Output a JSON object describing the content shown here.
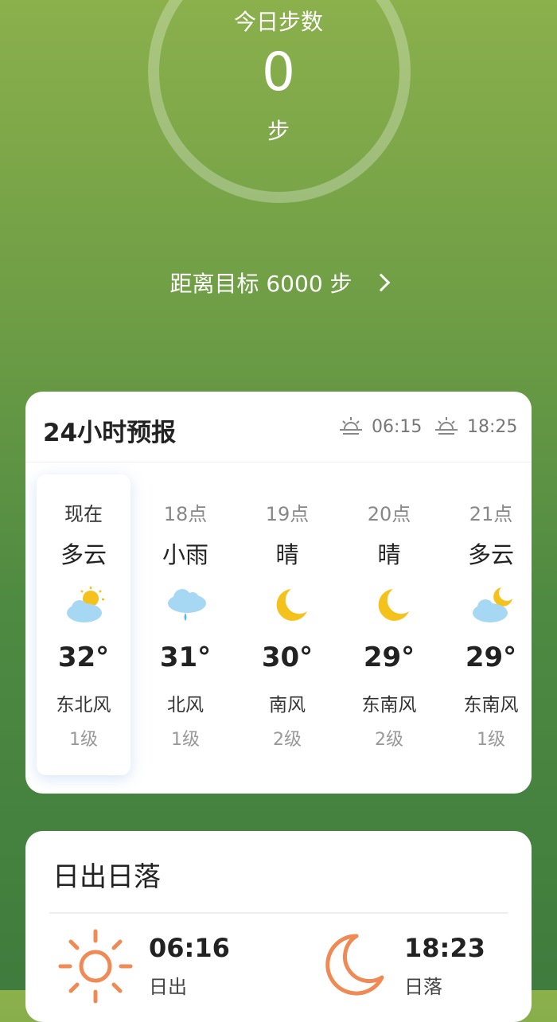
{
  "steps": {
    "title": "今日步数",
    "count": "0",
    "unit": "步",
    "goal_text": "距离目标 6000 步"
  },
  "forecast": {
    "title": "24小时预报",
    "sunrise": "06:15",
    "sunset": "18:25",
    "hours": [
      {
        "time": "现在",
        "condition": "多云",
        "icon": "partly-cloudy-icon",
        "temp": "32°",
        "wind": "东北风",
        "level": "1级"
      },
      {
        "time": "18点",
        "condition": "小雨",
        "icon": "rain-icon",
        "temp": "31°",
        "wind": "北风",
        "level": "1级"
      },
      {
        "time": "19点",
        "condition": "晴",
        "icon": "moon-icon",
        "temp": "30°",
        "wind": "南风",
        "level": "2级"
      },
      {
        "time": "20点",
        "condition": "晴",
        "icon": "moon-icon",
        "temp": "29°",
        "wind": "东南风",
        "level": "2级"
      },
      {
        "time": "21点",
        "condition": "多云",
        "icon": "cloudy-night-icon",
        "temp": "29°",
        "wind": "东南风",
        "level": "1级"
      }
    ]
  },
  "sun_card": {
    "title": "日出日落",
    "sunrise_time": "06:16",
    "sunrise_label": "日出",
    "sunset_time": "18:23",
    "sunset_label": "日落"
  },
  "colors": {
    "accent_orange": "#f08a55",
    "sun_yellow": "#f5c21b",
    "cloud_blue": "#8ecdf0"
  }
}
